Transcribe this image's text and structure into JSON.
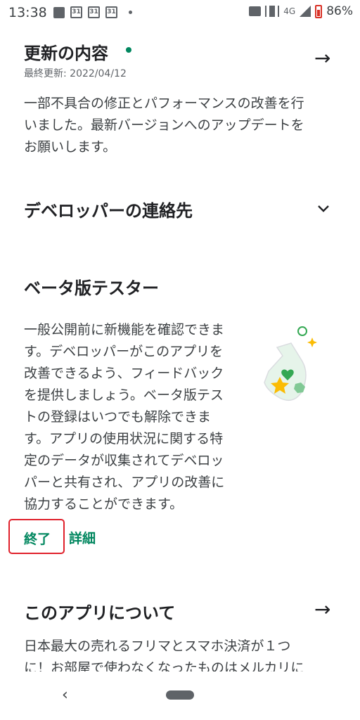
{
  "status_bar": {
    "time": "13:38",
    "calendar_icons": [
      "31",
      "31",
      "31"
    ],
    "network": "4G",
    "battery": "86%"
  },
  "whats_new": {
    "title": "更新の内容",
    "dot_color": "#01875f",
    "last_updated": "最終更新: 2022/04/12",
    "body_lines": [
      "一部不具合の修正とパフォーマンスの改善を行",
      "いました。最新バージョンへのアップデートを",
      "お願いします。"
    ]
  },
  "developer_contact": {
    "title": "デベロッパーの連絡先"
  },
  "beta": {
    "title": "ベータ版テスター",
    "body_lines": [
      "一般公開前に新機能を確認できま",
      "す。デベロッパーがこのアプリを",
      "改善できるよう、フィードバック",
      "を提供しましょう。ベータ版テス",
      "トの登録はいつでも解除できま",
      "す。アプリの使用状況に関する特",
      "定のデータが収集されてデベロッ",
      "パーと共有され、アプリの改善に",
      "協力することができます。"
    ],
    "leave_label": "終了",
    "details_label": "詳細"
  },
  "about": {
    "title": "このアプリについて",
    "body_lines": [
      "日本最大の売れるフリマとスマホ決済が１つ",
      "に！お部屋で使わなくなったものはメルカリに"
    ]
  },
  "colors": {
    "accent": "#01875f",
    "highlight_border": "#e0202b"
  }
}
